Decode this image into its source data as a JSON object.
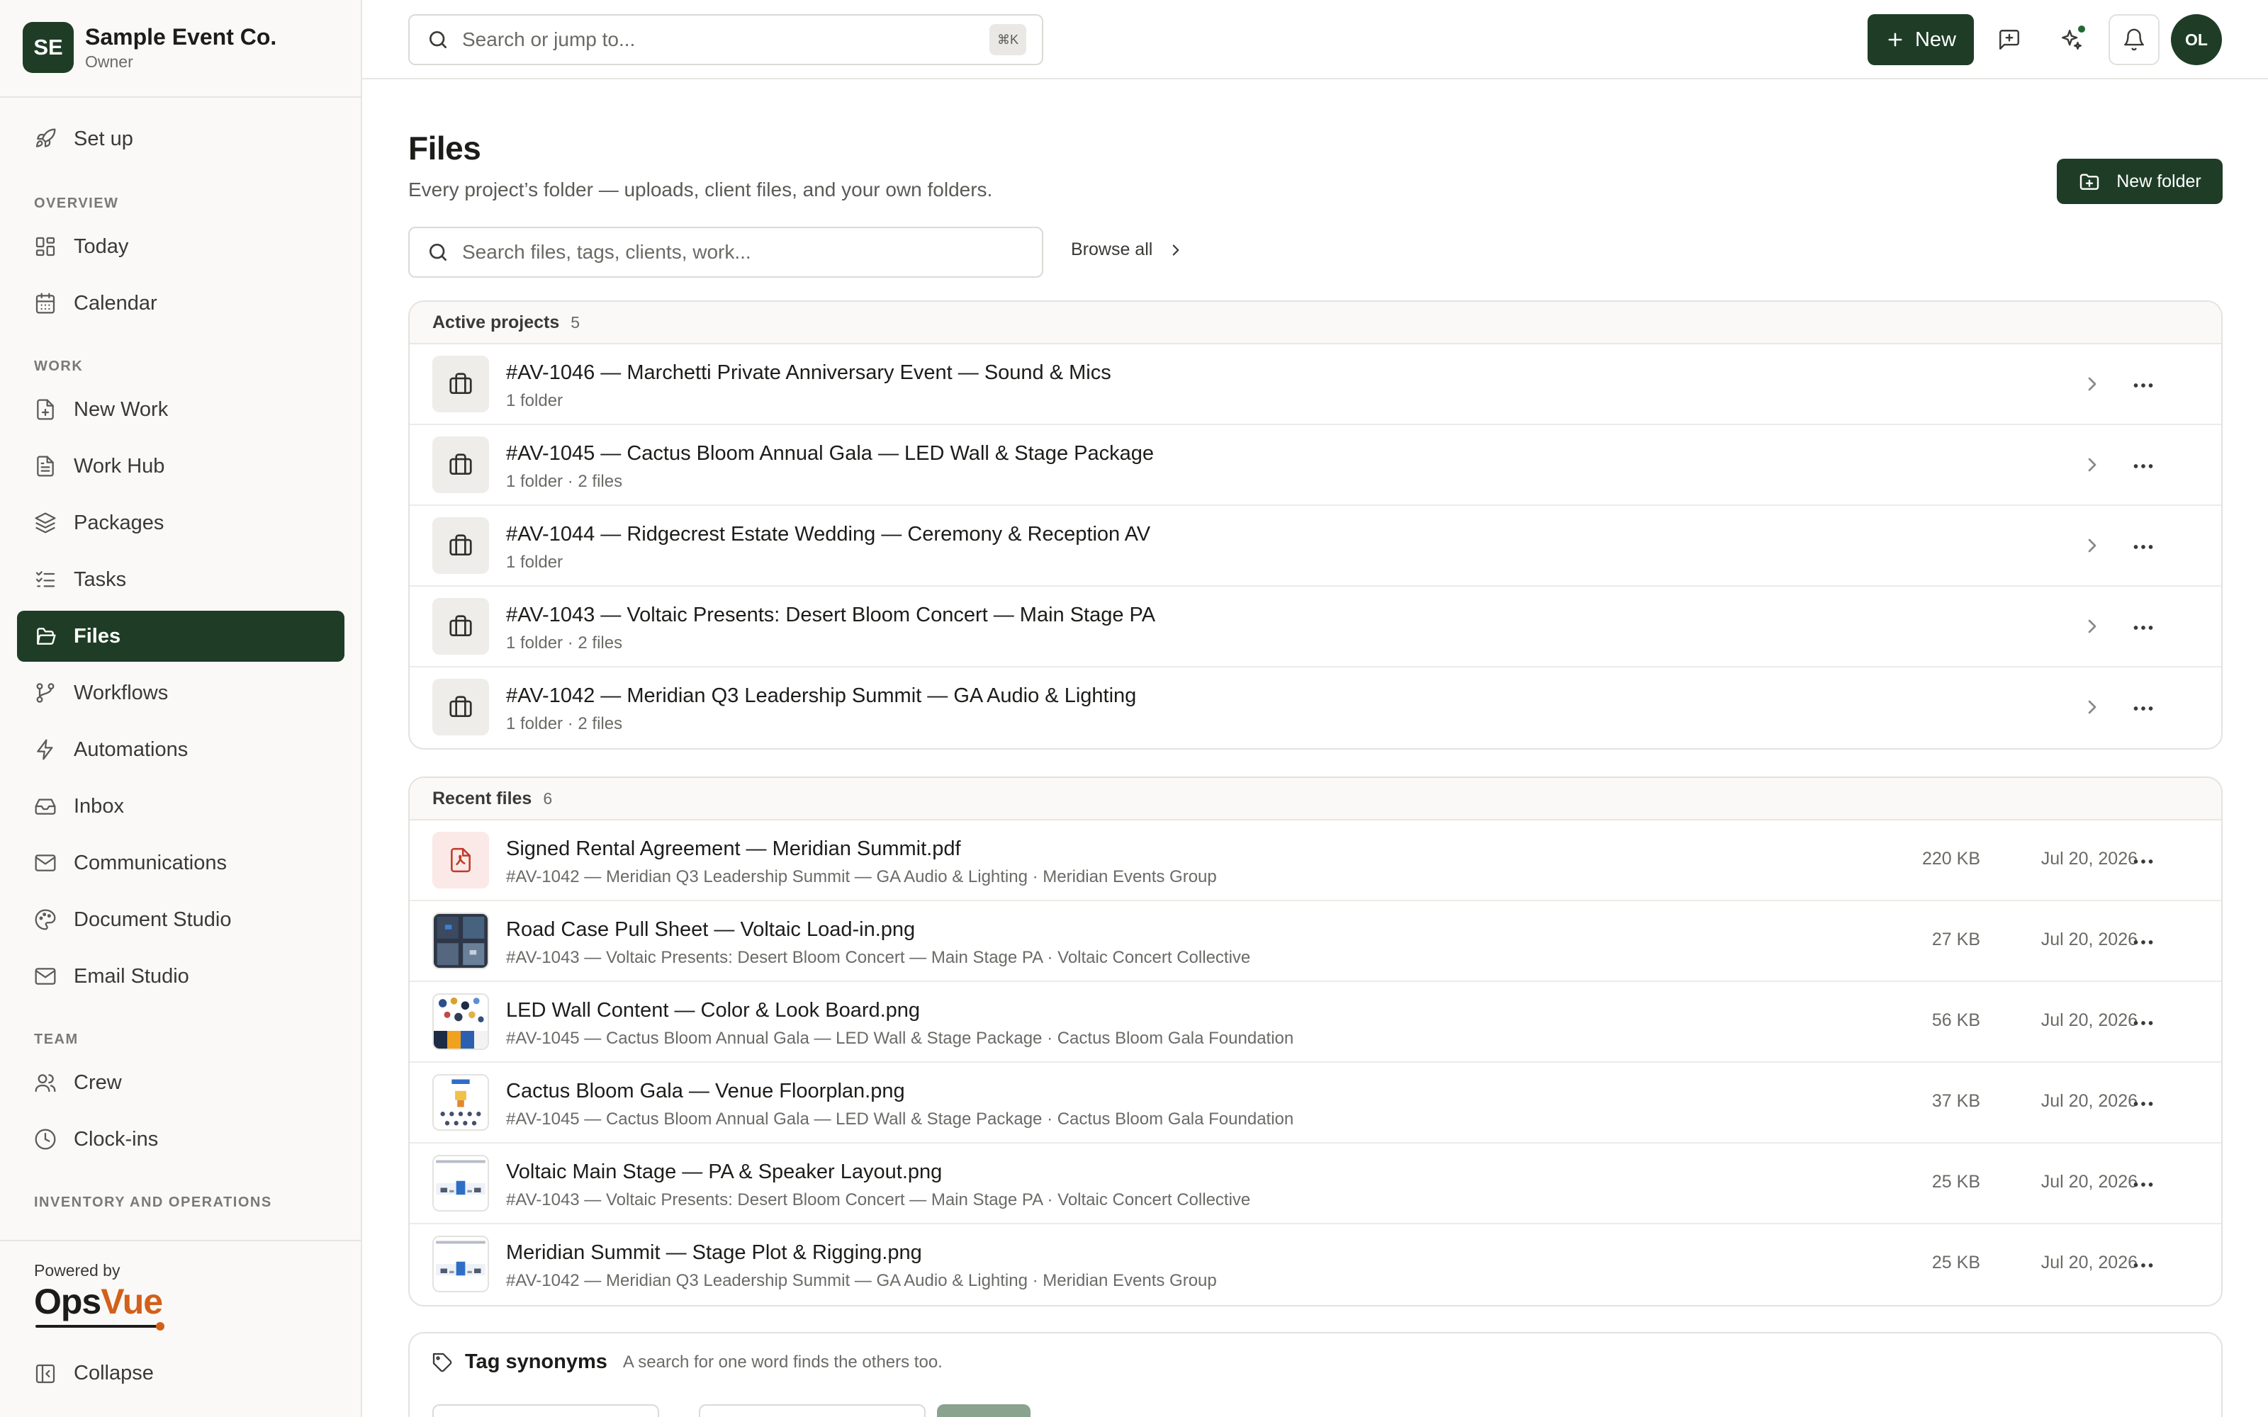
{
  "org": {
    "initials": "SE",
    "name": "Sample Event Co.",
    "role": "Owner"
  },
  "nav": {
    "setup": "Set up",
    "sections": {
      "overview": "OVERVIEW",
      "work": "WORK",
      "team": "TEAM",
      "inventory": "INVENTORY AND OPERATIONS"
    },
    "items": {
      "today": "Today",
      "calendar": "Calendar",
      "new_work": "New Work",
      "work_hub": "Work Hub",
      "packages": "Packages",
      "tasks": "Tasks",
      "files": "Files",
      "workflows": "Workflows",
      "automations": "Automations",
      "inbox": "Inbox",
      "communications": "Communications",
      "document_studio": "Document Studio",
      "email_studio": "Email Studio",
      "crew": "Crew",
      "clock_ins": "Clock-ins"
    },
    "active": "files"
  },
  "footer": {
    "powered_by": "Powered by",
    "brand_a": "Ops",
    "brand_b": "Vue",
    "collapse": "Collapse"
  },
  "topbar": {
    "search_placeholder": "Search or jump to...",
    "shortcut": "⌘K",
    "new_label": "New",
    "user_initials": "OL"
  },
  "page": {
    "title": "Files",
    "subtitle": "Every project’s folder — uploads, client files, and your own folders.",
    "new_folder": "New folder",
    "search_placeholder": "Search files, tags, clients, work...",
    "browse_all": "Browse all"
  },
  "active_projects": {
    "label": "Active projects",
    "count": "5",
    "items": [
      {
        "title": "#AV-1046 — Marchetti Private Anniversary Event — Sound & Mics",
        "meta": "1 folder"
      },
      {
        "title": "#AV-1045 — Cactus Bloom Annual Gala — LED Wall & Stage Package",
        "meta": "1 folder · 2 files"
      },
      {
        "title": "#AV-1044 — Ridgecrest Estate Wedding — Ceremony & Reception AV",
        "meta": "1 folder"
      },
      {
        "title": "#AV-1043 — Voltaic Presents: Desert Bloom Concert — Main Stage PA",
        "meta": "1 folder · 2 files"
      },
      {
        "title": "#AV-1042 — Meridian Q3 Leadership Summit — GA Audio & Lighting",
        "meta": "1 folder · 2 files"
      }
    ]
  },
  "recent_files": {
    "label": "Recent files",
    "count": "6",
    "items": [
      {
        "name": "Signed Rental Agreement — Meridian Summit.pdf",
        "meta": "#AV-1042 — Meridian Q3 Leadership Summit — GA Audio & Lighting · Meridian Events Group",
        "size": "220 KB",
        "date": "Jul 20, 2026",
        "thumb": "pdf-icon"
      },
      {
        "name": "Road Case Pull Sheet — Voltaic Load-in.png",
        "meta": "#AV-1043 — Voltaic Presents: Desert Bloom Concert — Main Stage PA · Voltaic Concert Collective",
        "size": "27 KB",
        "date": "Jul 20, 2026",
        "thumb": "grid-image"
      },
      {
        "name": "LED Wall Content — Color & Look Board.png",
        "meta": "#AV-1045 — Cactus Bloom Annual Gala — LED Wall & Stage Package · Cactus Bloom Gala Foundation",
        "size": "56 KB",
        "date": "Jul 20, 2026",
        "thumb": "moodboard-image"
      },
      {
        "name": "Cactus Bloom Gala — Venue Floorplan.png",
        "meta": "#AV-1045 — Cactus Bloom Annual Gala — LED Wall & Stage Package · Cactus Bloom Gala Foundation",
        "size": "37 KB",
        "date": "Jul 20, 2026",
        "thumb": "floorplan-image"
      },
      {
        "name": "Voltaic Main Stage — PA & Speaker Layout.png",
        "meta": "#AV-1043 — Voltaic Presents: Desert Bloom Concert — Main Stage PA · Voltaic Concert Collective",
        "size": "25 KB",
        "date": "Jul 20, 2026",
        "thumb": "stage-image"
      },
      {
        "name": "Meridian Summit — Stage Plot & Rigging.png",
        "meta": "#AV-1042 — Meridian Q3 Leadership Summit — GA Audio & Lighting · Meridian Events Group",
        "size": "25 KB",
        "date": "Jul 20, 2026",
        "thumb": "stage-image"
      }
    ]
  },
  "tag_synonyms": {
    "title": "Tag synonyms",
    "subtitle": "A search for one word finds the others too."
  },
  "colors": {
    "brand_green": "#1f3d26",
    "accent_orange": "#d2601a",
    "pdf_red": "#c0392b"
  }
}
